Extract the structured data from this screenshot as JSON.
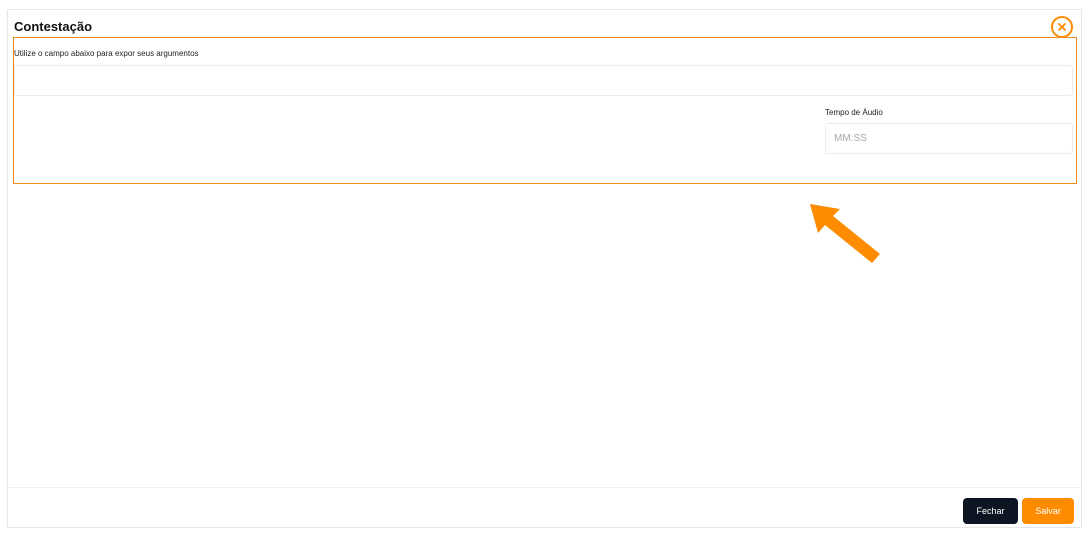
{
  "modal": {
    "title": "Contestação",
    "close_icon": "close-circle-icon"
  },
  "form": {
    "instruction": "Utilize o campo abaixo para expor seus argumentos",
    "argument_value": "",
    "audio_label": "Tempo de Áudio",
    "audio_placeholder": "MM:SS",
    "audio_value": ""
  },
  "annotation": {
    "arrow_icon": "arrow-up-left-icon",
    "highlight_color": "#f08c1e"
  },
  "footer": {
    "close_label": "Fechar",
    "save_label": "Salvar"
  },
  "colors": {
    "accent": "#ff8c00",
    "dark_button": "#0e1522"
  }
}
